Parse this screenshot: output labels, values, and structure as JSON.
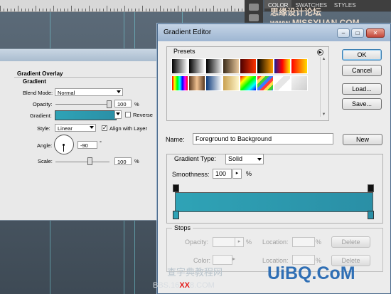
{
  "workspace": {
    "panel_tabs": [
      "COLOR",
      "SWATCHES",
      "STYLES"
    ],
    "watermark_top": "思缘设计论坛 www.MISSYUAN.COM"
  },
  "layer_style": {
    "section_title": "Gradient Overlay",
    "group_title": "Gradient",
    "blend_mode_label": "Blend Mode:",
    "blend_mode_value": "Normal",
    "opacity_label": "Opacity:",
    "opacity_value": "100",
    "opacity_unit": "%",
    "gradient_label": "Gradient:",
    "gradient_colors": [
      "#2fa3b6",
      "#2a8fa6"
    ],
    "reverse_label": "Reverse",
    "reverse_checked": false,
    "style_label": "Style:",
    "style_value": "Linear",
    "align_label": "Align with Layer",
    "align_checked": true,
    "angle_label": "Angle:",
    "angle_value": "-90",
    "angle_unit": "°",
    "scale_label": "Scale:",
    "scale_value": "100",
    "scale_unit": "%"
  },
  "gradient_editor": {
    "title": "Gradient Editor",
    "presets_label": "Presets",
    "buttons": {
      "ok": "OK",
      "cancel": "Cancel",
      "load": "Load...",
      "save": "Save...",
      "new": "New",
      "delete": "Delete"
    },
    "name_label": "Name:",
    "name_value": "Foreground to Background",
    "gradient_type_label": "Gradient Type:",
    "gradient_type_value": "Solid",
    "smoothness_label": "Smoothness:",
    "smoothness_value": "100",
    "smoothness_unit": "%",
    "stops_label": "Stops",
    "opacity_label": "Opacity:",
    "color_label": "Color:",
    "location_label": "Location:",
    "percent": "%",
    "bar_colors": [
      "#2fa3b6",
      "#2a8fa6"
    ],
    "presets": [
      "linear-gradient(90deg,#000,#fff)",
      "linear-gradient(90deg,#000,#fff)",
      "linear-gradient(90deg,#000,rgba(0,0,0,0))",
      "linear-gradient(90deg,#3b2b1a,#e8c79a)",
      "linear-gradient(90deg,#4a0000,#ff3300)",
      "linear-gradient(90deg,#000,#ff9900)",
      "linear-gradient(90deg,#1a1a9a,#ff0000,#ffee00)",
      "linear-gradient(90deg,#ff0000,#ffdd00)",
      "linear-gradient(90deg,#ff0000,#ffff00,#00ff00,#00ffff,#0000ff,#ff00ff,#ff0000)",
      "linear-gradient(90deg,#5a3a20,#f0c090,#5a3a20)",
      "linear-gradient(90deg,#0b3a7a,#ffffff)",
      "linear-gradient(90deg,#c9a050,#fff6c8)",
      "linear-gradient(135deg,#ff0000,#ffff00,#00ff00,#00ffff,#0000ff)",
      "repeating-linear-gradient(135deg,#ff3b3b 0 4px,#ffe04b 4px 8px,#3bcf3b 8px 12px,#3b7bff 12px 16px)",
      "linear-gradient(135deg,#fff 0 30%,#e6e6e6 30% 60%,#fff 60%)",
      "linear-gradient(135deg,#f2f2f2,#cfcfcf)"
    ]
  },
  "overlay": {
    "bottom_cn": "查字典教程网",
    "bottom_logo": "UiBQ.CoM",
    "bottom_url_pre": "BBS.16",
    "bottom_url_xx": "XX",
    "bottom_url_post": "8.COM"
  }
}
